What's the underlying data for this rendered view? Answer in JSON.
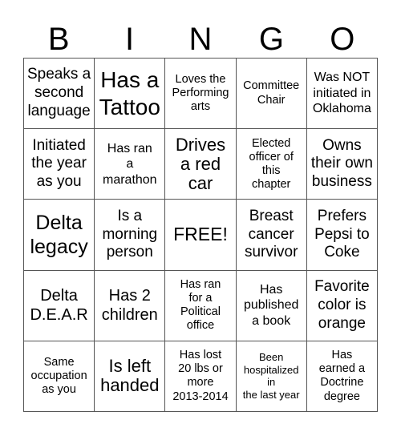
{
  "header": {
    "letters": [
      "B",
      "I",
      "N",
      "G",
      "O"
    ]
  },
  "board": {
    "rows": [
      [
        "Speaks a\nsecond\nlanguage",
        "Has a\nTattoo",
        "Loves the\nPerforming\narts",
        "Committee\nChair",
        "Was NOT\ninitiated in\nOklahoma"
      ],
      [
        "Initiated\nthe year\nas you",
        "Has ran\na\nmarathon",
        "Drives\na red\ncar",
        "Elected\nofficer of\nthis\nchapter",
        "Owns\ntheir own\nbusiness"
      ],
      [
        "Delta\nlegacy",
        "Is a\nmorning\nperson",
        "FREE!",
        "Breast\ncancer\nsurvivor",
        "Prefers\nPepsi to\nCoke"
      ],
      [
        "Delta\nD.E.A.R",
        "Has 2\nchildren",
        "Has ran\nfor a\nPolitical\noffice",
        "Has\npublished\na book",
        "Favorite\ncolor is\norange"
      ],
      [
        "Same\noccupation\nas you",
        "Is left\nhanded",
        "Has lost\n20 lbs or\nmore\n2013-2014",
        "Been\nhospitalized\nin\nthe last year",
        "Has\nearned a\nDoctrine\ndegree"
      ]
    ],
    "free_space": "FREE!"
  }
}
